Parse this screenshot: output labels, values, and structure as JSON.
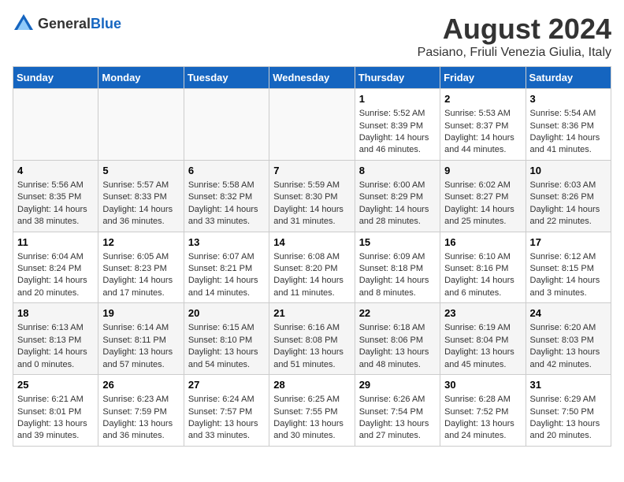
{
  "header": {
    "logo_general": "General",
    "logo_blue": "Blue",
    "month_year": "August 2024",
    "location": "Pasiano, Friuli Venezia Giulia, Italy"
  },
  "days_of_week": [
    "Sunday",
    "Monday",
    "Tuesday",
    "Wednesday",
    "Thursday",
    "Friday",
    "Saturday"
  ],
  "weeks": [
    [
      {
        "day": "",
        "info": ""
      },
      {
        "day": "",
        "info": ""
      },
      {
        "day": "",
        "info": ""
      },
      {
        "day": "",
        "info": ""
      },
      {
        "day": "1",
        "info": "Sunrise: 5:52 AM\nSunset: 8:39 PM\nDaylight: 14 hours and 46 minutes."
      },
      {
        "day": "2",
        "info": "Sunrise: 5:53 AM\nSunset: 8:37 PM\nDaylight: 14 hours and 44 minutes."
      },
      {
        "day": "3",
        "info": "Sunrise: 5:54 AM\nSunset: 8:36 PM\nDaylight: 14 hours and 41 minutes."
      }
    ],
    [
      {
        "day": "4",
        "info": "Sunrise: 5:56 AM\nSunset: 8:35 PM\nDaylight: 14 hours and 38 minutes."
      },
      {
        "day": "5",
        "info": "Sunrise: 5:57 AM\nSunset: 8:33 PM\nDaylight: 14 hours and 36 minutes."
      },
      {
        "day": "6",
        "info": "Sunrise: 5:58 AM\nSunset: 8:32 PM\nDaylight: 14 hours and 33 minutes."
      },
      {
        "day": "7",
        "info": "Sunrise: 5:59 AM\nSunset: 8:30 PM\nDaylight: 14 hours and 31 minutes."
      },
      {
        "day": "8",
        "info": "Sunrise: 6:00 AM\nSunset: 8:29 PM\nDaylight: 14 hours and 28 minutes."
      },
      {
        "day": "9",
        "info": "Sunrise: 6:02 AM\nSunset: 8:27 PM\nDaylight: 14 hours and 25 minutes."
      },
      {
        "day": "10",
        "info": "Sunrise: 6:03 AM\nSunset: 8:26 PM\nDaylight: 14 hours and 22 minutes."
      }
    ],
    [
      {
        "day": "11",
        "info": "Sunrise: 6:04 AM\nSunset: 8:24 PM\nDaylight: 14 hours and 20 minutes."
      },
      {
        "day": "12",
        "info": "Sunrise: 6:05 AM\nSunset: 8:23 PM\nDaylight: 14 hours and 17 minutes."
      },
      {
        "day": "13",
        "info": "Sunrise: 6:07 AM\nSunset: 8:21 PM\nDaylight: 14 hours and 14 minutes."
      },
      {
        "day": "14",
        "info": "Sunrise: 6:08 AM\nSunset: 8:20 PM\nDaylight: 14 hours and 11 minutes."
      },
      {
        "day": "15",
        "info": "Sunrise: 6:09 AM\nSunset: 8:18 PM\nDaylight: 14 hours and 8 minutes."
      },
      {
        "day": "16",
        "info": "Sunrise: 6:10 AM\nSunset: 8:16 PM\nDaylight: 14 hours and 6 minutes."
      },
      {
        "day": "17",
        "info": "Sunrise: 6:12 AM\nSunset: 8:15 PM\nDaylight: 14 hours and 3 minutes."
      }
    ],
    [
      {
        "day": "18",
        "info": "Sunrise: 6:13 AM\nSunset: 8:13 PM\nDaylight: 14 hours and 0 minutes."
      },
      {
        "day": "19",
        "info": "Sunrise: 6:14 AM\nSunset: 8:11 PM\nDaylight: 13 hours and 57 minutes."
      },
      {
        "day": "20",
        "info": "Sunrise: 6:15 AM\nSunset: 8:10 PM\nDaylight: 13 hours and 54 minutes."
      },
      {
        "day": "21",
        "info": "Sunrise: 6:16 AM\nSunset: 8:08 PM\nDaylight: 13 hours and 51 minutes."
      },
      {
        "day": "22",
        "info": "Sunrise: 6:18 AM\nSunset: 8:06 PM\nDaylight: 13 hours and 48 minutes."
      },
      {
        "day": "23",
        "info": "Sunrise: 6:19 AM\nSunset: 8:04 PM\nDaylight: 13 hours and 45 minutes."
      },
      {
        "day": "24",
        "info": "Sunrise: 6:20 AM\nSunset: 8:03 PM\nDaylight: 13 hours and 42 minutes."
      }
    ],
    [
      {
        "day": "25",
        "info": "Sunrise: 6:21 AM\nSunset: 8:01 PM\nDaylight: 13 hours and 39 minutes."
      },
      {
        "day": "26",
        "info": "Sunrise: 6:23 AM\nSunset: 7:59 PM\nDaylight: 13 hours and 36 minutes."
      },
      {
        "day": "27",
        "info": "Sunrise: 6:24 AM\nSunset: 7:57 PM\nDaylight: 13 hours and 33 minutes."
      },
      {
        "day": "28",
        "info": "Sunrise: 6:25 AM\nSunset: 7:55 PM\nDaylight: 13 hours and 30 minutes."
      },
      {
        "day": "29",
        "info": "Sunrise: 6:26 AM\nSunset: 7:54 PM\nDaylight: 13 hours and 27 minutes."
      },
      {
        "day": "30",
        "info": "Sunrise: 6:28 AM\nSunset: 7:52 PM\nDaylight: 13 hours and 24 minutes."
      },
      {
        "day": "31",
        "info": "Sunrise: 6:29 AM\nSunset: 7:50 PM\nDaylight: 13 hours and 20 minutes."
      }
    ]
  ]
}
